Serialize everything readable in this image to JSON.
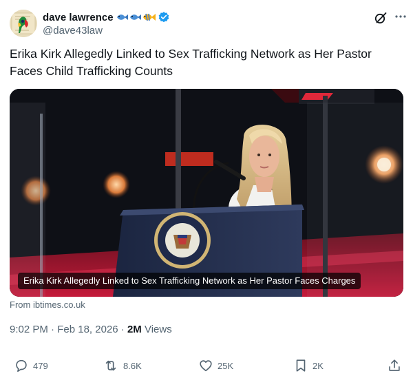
{
  "author": {
    "display_name": "dave lawrence",
    "handle": "@dave43law",
    "name_emojis": [
      "fish-emoji",
      "fish-emoji",
      "tropical-fish-emoji"
    ],
    "verified": true
  },
  "post": {
    "text": "Erika Kirk Allegedly Linked to Sex Trafficking Network as Her Pastor Faces Child Trafficking Counts"
  },
  "media": {
    "caption": "Erika Kirk Allegedly Linked to Sex Trafficking Network as Her Pastor Faces Charges",
    "source": "From ibtimes.co.uk"
  },
  "meta": {
    "time": "9:02 PM",
    "separator": "·",
    "date": "Feb 18, 2026",
    "views_count": "2M",
    "views_label": "Views"
  },
  "actions": {
    "replies": "479",
    "reposts": "8.6K",
    "likes": "25K",
    "bookmarks": "2K"
  },
  "colors": {
    "text_primary": "#0f1419",
    "text_secondary": "#536471",
    "verified_blue": "#1d9bf0"
  }
}
